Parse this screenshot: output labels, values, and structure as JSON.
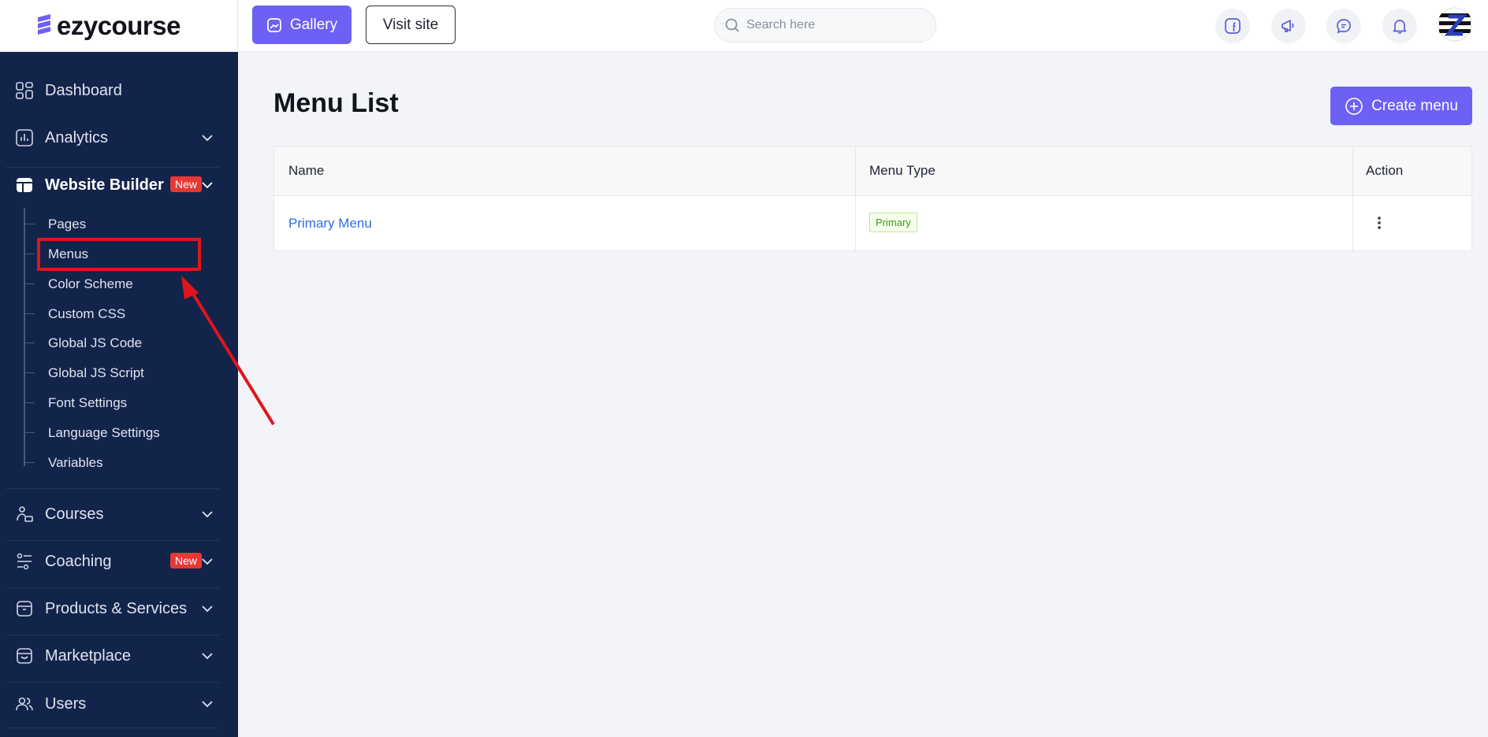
{
  "brand": {
    "logo_text": "ezycourse"
  },
  "header": {
    "gallery_label": "Gallery",
    "visit_site_label": "Visit site",
    "search_placeholder": "Search here"
  },
  "sidebar": {
    "items": [
      {
        "label": "Dashboard",
        "icon": "dashboard-icon"
      },
      {
        "label": "Analytics",
        "icon": "analytics-icon"
      },
      {
        "label": "Website Builder",
        "icon": "website-builder-icon",
        "badge": "New"
      },
      {
        "label": "Courses",
        "icon": "courses-icon"
      },
      {
        "label": "Coaching",
        "icon": "coaching-icon",
        "badge": "New"
      },
      {
        "label": "Products & Services",
        "icon": "products-icon"
      },
      {
        "label": "Marketplace",
        "icon": "marketplace-icon"
      },
      {
        "label": "Users",
        "icon": "users-icon"
      }
    ],
    "website_builder_sub": [
      "Pages",
      "Menus",
      "Color Scheme",
      "Custom CSS",
      "Global JS Code",
      "Global JS Script",
      "Font Settings",
      "Language Settings",
      "Variables"
    ]
  },
  "main": {
    "title": "Menu List",
    "create_button_label": "Create menu",
    "table": {
      "columns": [
        "Name",
        "Menu Type",
        "Action"
      ],
      "rows": [
        {
          "name": "Primary Menu",
          "type": "Primary"
        }
      ]
    }
  },
  "colors": {
    "accent": "#6d60f5",
    "sidebar_bg": "#13244b",
    "badge_red": "#e53935",
    "link_blue": "#2f6de0"
  }
}
